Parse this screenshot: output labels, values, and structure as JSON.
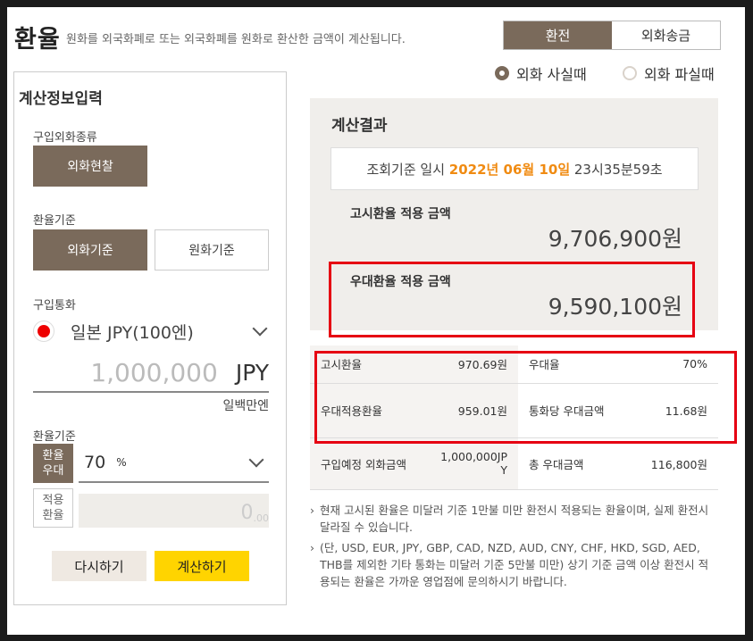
{
  "header": {
    "title": "환율",
    "description": "원화를 외국화폐로 또는 외국화폐를 원화로 환산한 금액이 계산됩니다.",
    "tabs": [
      {
        "label": "환전",
        "active": true
      },
      {
        "label": "외화송금",
        "active": false
      }
    ]
  },
  "mode": {
    "options": [
      {
        "label": "외화 사실때",
        "selected": true
      },
      {
        "label": "외화 파실때",
        "selected": false
      }
    ]
  },
  "input": {
    "heading": "계산정보입력",
    "purchase_type_label": "구입외화종류",
    "purchase_type_button": "외화현찰",
    "rate_basis_label": "환율기준",
    "rate_basis_options": [
      "외화기준",
      "원화기준"
    ],
    "currency_label": "구입통화",
    "currency_value": "일본 JPY(100엔)",
    "amount_value": "1,000,000",
    "amount_unit": "JPY",
    "amount_korean": "일백만엔",
    "preferential_label": "환율기준",
    "preferential_tag": "환율\n우대",
    "preferential_value": "70",
    "preferential_unit": "%",
    "applied_tag": "적용\n환율",
    "applied_value": "0",
    "applied_decimal": ".00",
    "reset_button": "다시하기",
    "calc_button": "계산하기"
  },
  "result": {
    "heading": "계산결과",
    "date_prefix": "조회기준 일시 ",
    "date_highlight": "2022년 06월 10일",
    "date_time": " 23시35분59초",
    "notice_label": "고시환율 적용 금액",
    "notice_amount": "9,706,900원",
    "pref_label": "우대환율 적용 금액",
    "pref_amount": "9,590,100원",
    "table": [
      [
        "고시환율",
        "970.69원",
        "우대율",
        "70%"
      ],
      [
        "우대적용환율",
        "959.01원",
        "통화당 우대금액",
        "11.68원"
      ],
      [
        "구입예정 외화금액",
        "1,000,000JPY",
        "총 우대금액",
        "116,800원"
      ]
    ],
    "notes": [
      "현재 고시된 환율은 미달러 기준 1만불 미만 환전시 적용되는 환율이며, 실제 환전시 달라질 수 있습니다.",
      "(단, USD, EUR, JPY, GBP, CAD, NZD, AUD, CNY, CHF, HKD, SGD, AED, THB를 제외한 기타 통화는 미달러 기준 5만불 미만) 상기 기준 금액 이상 환전시 적용되는 환율은 가까운 영업점에 문의하시기 바랍니다."
    ]
  },
  "colors": {
    "brown": "#7a6a5b",
    "orange": "#f08b12",
    "highlight_red": "#e60012",
    "yellow": "#ffd400"
  }
}
